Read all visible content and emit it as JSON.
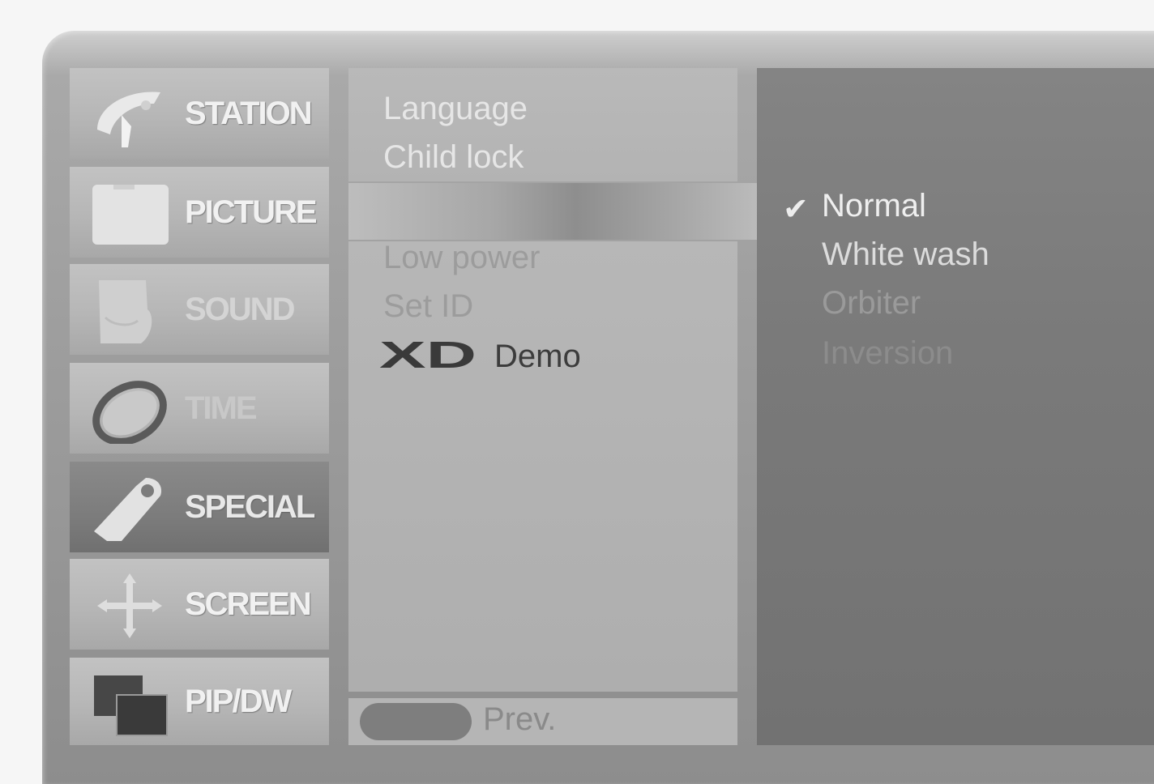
{
  "categories": [
    {
      "label": "STATION",
      "icon": "satellite-dish-icon",
      "state": "normal"
    },
    {
      "label": "PICTURE",
      "icon": "picture-card-icon",
      "state": "normal"
    },
    {
      "label": "SOUND",
      "icon": "speaker-icon",
      "state": "faded"
    },
    {
      "label": "TIME",
      "icon": "clock-ring-icon",
      "state": "faded"
    },
    {
      "label": "SPECIAL",
      "icon": "tag-icon",
      "state": "selected"
    },
    {
      "label": "SCREEN",
      "icon": "move-arrows-icon",
      "state": "normal"
    },
    {
      "label": "PIP/DW",
      "icon": "stacked-windows-icon",
      "state": "normal"
    }
  ],
  "submenu": {
    "items": [
      "Language",
      "Child lock",
      "Low power",
      "Set ID",
      "Demo"
    ],
    "logo_text": "XD",
    "prev_label": "Prev."
  },
  "options": {
    "items": [
      "Normal",
      "White wash",
      "Orbiter",
      "Inversion"
    ],
    "selected": "Normal",
    "check_glyph": "✔"
  },
  "colors": {
    "selected_category_bg": "#7c7c7c",
    "option_panel_bg": "#7a7a7a",
    "menu_text": "#e6e6e6"
  }
}
